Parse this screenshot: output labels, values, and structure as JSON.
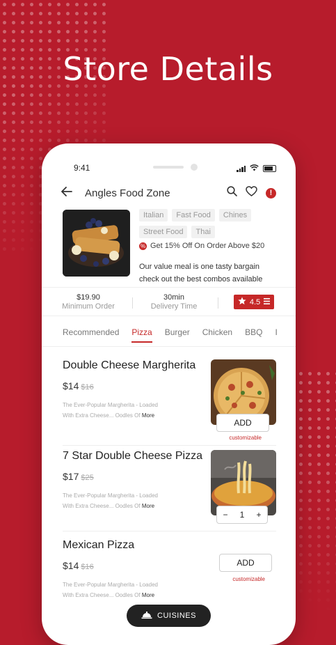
{
  "banner": {
    "title": "Store Details"
  },
  "status_bar": {
    "time": "9:41"
  },
  "header": {
    "store_name": "Angles Food Zone"
  },
  "store": {
    "tags": [
      "Italian",
      "Fast Food",
      "Chines",
      "Street Food",
      "Thai"
    ],
    "offer": "Get 15% Off On Order Above $20",
    "description_line1": "Our value meal is one tasty bargain",
    "description_line2": "check out the best combos available"
  },
  "stats": {
    "min_order_value": "$19.90",
    "min_order_label": "Minimum Order",
    "delivery_value": "30min",
    "delivery_label": "Delivery Time",
    "rating": "4.5"
  },
  "tabs": [
    "Recommended",
    "Pizza",
    "Burger",
    "Chicken",
    "BBQ",
    "I"
  ],
  "active_tab": "Pizza",
  "items": [
    {
      "name": "Double Cheese Margherita",
      "price": "$14",
      "old_price": "$16",
      "desc_line1": "The Ever-Popular Margherita - Loaded",
      "desc_line2": "With Extra Cheese... Oodles Of",
      "more": "More",
      "action": "ADD",
      "note": "customizable"
    },
    {
      "name": "7 Star Double Cheese Pizza",
      "price": "$17",
      "old_price": "$25",
      "desc_line1": "The Ever-Popular Margherita - Loaded",
      "desc_line2": "With Extra Cheese... Oodles Of",
      "more": "More",
      "quantity": "1",
      "minus": "−",
      "plus": "+"
    },
    {
      "name": "Mexican Pizza",
      "price": "$14",
      "old_price": "$16",
      "desc_line1": "The Ever-Popular Margherita - Loaded",
      "desc_line2": "With Extra Cheese... Oodles Of",
      "more": "More",
      "action": "ADD",
      "note": "customizable"
    }
  ],
  "bottom": {
    "cuisines_label": "CUISINES"
  },
  "colors": {
    "brand_red": "#b71c2c",
    "accent_red": "#c62828",
    "pill_dark": "#222222"
  }
}
